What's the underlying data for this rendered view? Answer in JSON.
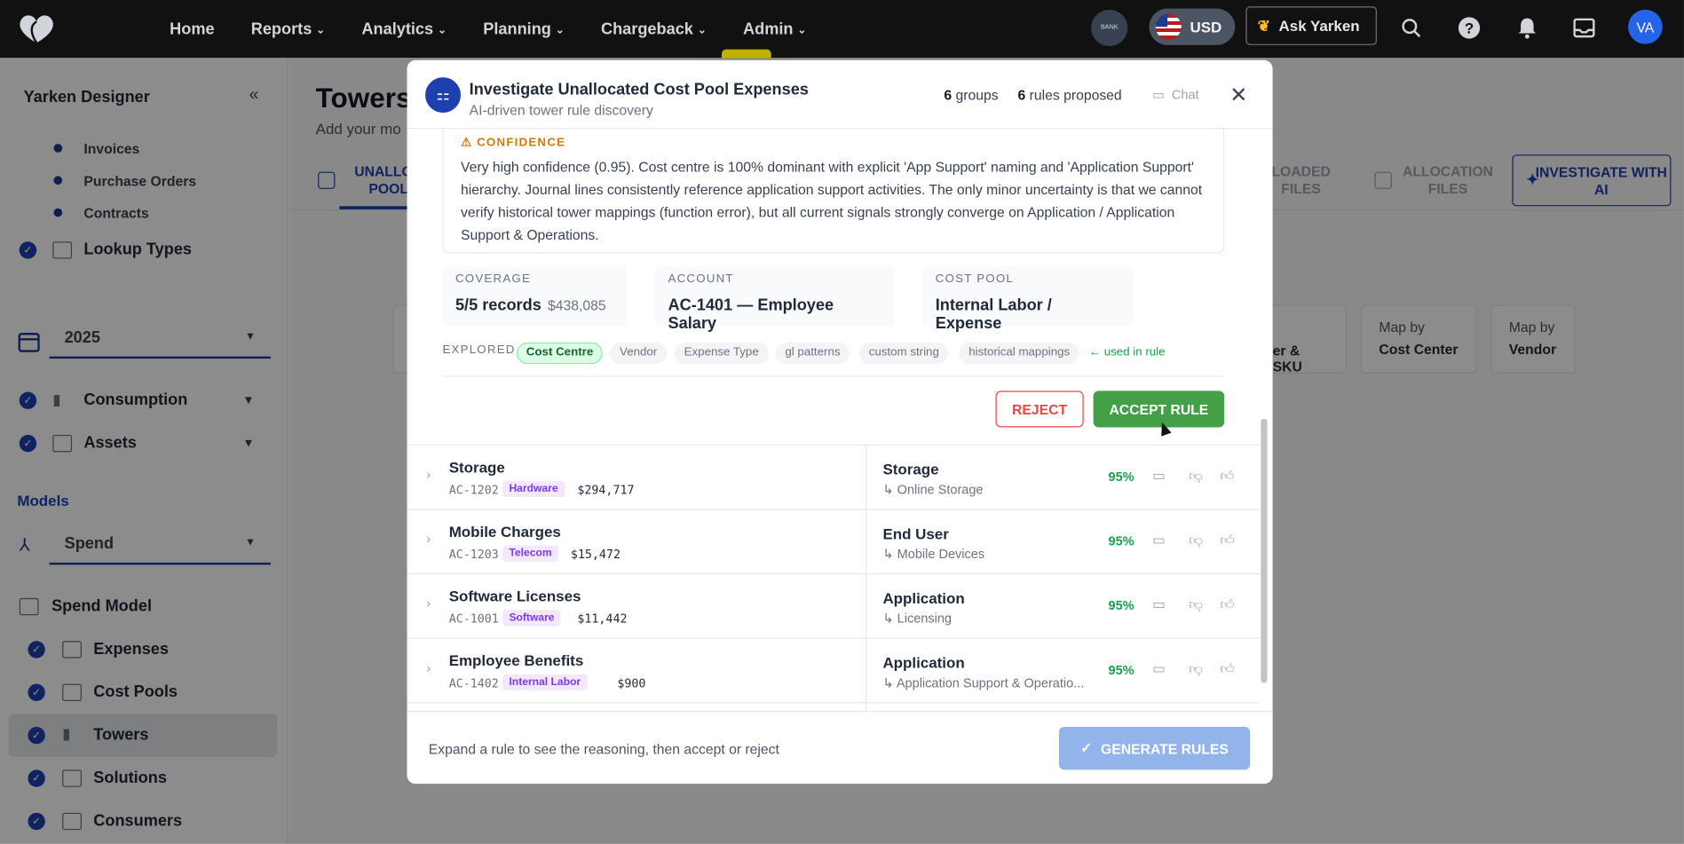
{
  "nav": {
    "items": [
      {
        "label": "Home",
        "dd": false
      },
      {
        "label": "Reports",
        "dd": true
      },
      {
        "label": "Analytics",
        "dd": true
      },
      {
        "label": "Planning",
        "dd": true
      },
      {
        "label": "Chargeback",
        "dd": true
      },
      {
        "label": "Admin",
        "dd": true
      }
    ],
    "bank_label": "BANK",
    "currency": "USD",
    "ask_label": "Ask Yarken",
    "avatar": "VA"
  },
  "sidebar": {
    "title": "Yarken Designer",
    "sub_items": [
      "Invoices",
      "Purchase Orders",
      "Contracts"
    ],
    "lookup": "Lookup Types",
    "year": "2025",
    "consumption": "Consumption",
    "assets": "Assets",
    "models_label": "Models",
    "model_select": "Spend",
    "spend_model": "Spend Model",
    "model_items": [
      "Expenses",
      "Cost Pools",
      "Towers",
      "Solutions",
      "Consumers"
    ]
  },
  "main": {
    "title": "Towers",
    "subtitle": "Add your mo",
    "tabs": [
      "UNALLOC",
      "POOL",
      "LOADED",
      "FILES",
      "ALLOCATION",
      "FILES"
    ],
    "investigate": "INVESTIGATE WITH AI",
    "map_cards": [
      {
        "pre": "",
        "label": "er & SKU"
      },
      {
        "pre": "Map by",
        "label": "Cost Center"
      },
      {
        "pre": "Map by",
        "label": "Vendor"
      }
    ]
  },
  "modal": {
    "title": "Investigate Unallocated Cost Pool Expenses",
    "subtitle": "AI-driven tower rule discovery",
    "groups_n": "6",
    "groups_label": "groups",
    "rules_n": "6",
    "rules_label": "rules proposed",
    "chat": "Chat",
    "confidence_label": "CONFIDENCE",
    "confidence_text": "Very high confidence (0.95). Cost centre is 100% dominant with explicit 'App Support' naming and 'Application Support' hierarchy. Journal lines consistently reference application support activities. The only minor uncertainty is that we cannot verify historical tower mappings (function error), but all current signals strongly converge on Application / Application Support & Operations.",
    "coverage_label": "COVERAGE",
    "coverage_val": "5/5 records",
    "coverage_amt": "$438,085",
    "account_label": "ACCOUNT",
    "account_val": "AC-1401 — Employee Salary",
    "pool_label": "COST POOL",
    "pool_val": "Internal Labor / Expense",
    "explored_label": "EXPLORED",
    "chips": [
      "Cost Centre",
      "Vendor",
      "Expense Type",
      "gl patterns",
      "custom string",
      "historical mappings"
    ],
    "used_label": "← used in rule",
    "reject": "REJECT",
    "accept": "ACCEPT RULE",
    "rows": [
      {
        "name": "Storage",
        "code": "AC-1202",
        "tag": "Hardware",
        "amount": "$294,717",
        "tower": "Storage",
        "sub": "Online Storage",
        "pct": "95%"
      },
      {
        "name": "Mobile Charges",
        "code": "AC-1203",
        "tag": "Telecom",
        "amount": "$15,472",
        "tower": "End User",
        "sub": "Mobile Devices",
        "pct": "95%"
      },
      {
        "name": "Software Licenses",
        "code": "AC-1001",
        "tag": "Software",
        "amount": "$11,442",
        "tower": "Application",
        "sub": "Licensing",
        "pct": "95%"
      },
      {
        "name": "Employee Benefits",
        "code": "AC-1402",
        "tag": "Internal Labor",
        "amount": "$900",
        "tower": "Application",
        "sub": "Application Support & Operatio...",
        "pct": "95%"
      }
    ],
    "footer_text": "Expand a rule to see the reasoning, then accept or reject",
    "generate": "GENERATE RULES"
  }
}
